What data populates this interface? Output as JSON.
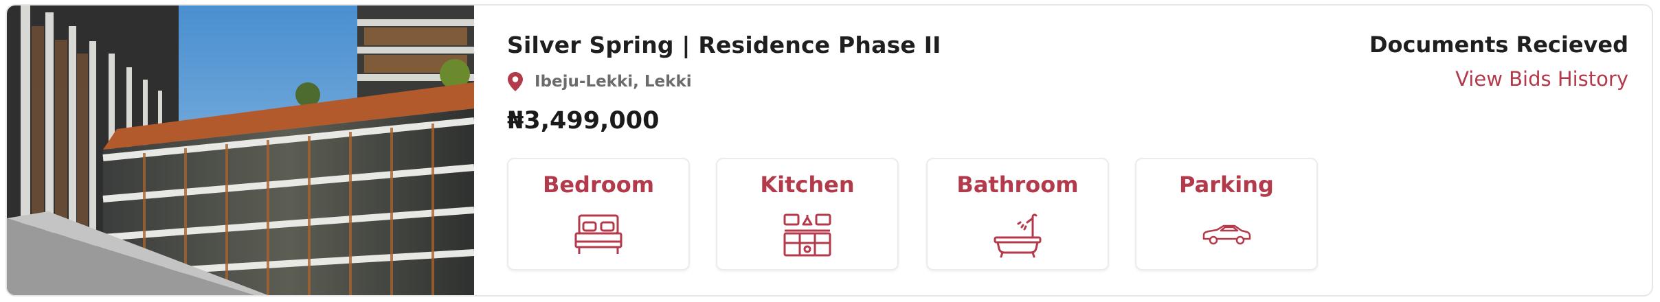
{
  "listing": {
    "title": "Silver Spring | Residence Phase II",
    "location": "Ibeju-Lekki, Lekki",
    "price": "₦3,499,000",
    "status": "Documents Recieved",
    "bids_link": "View Bids History",
    "accent_color": "#b33a4a"
  },
  "amenities": [
    {
      "label": "Bedroom",
      "icon": "bed-icon"
    },
    {
      "label": "Kitchen",
      "icon": "kitchen-icon"
    },
    {
      "label": "Bathroom",
      "icon": "bathtub-icon"
    },
    {
      "label": "Parking",
      "icon": "car-icon"
    }
  ]
}
